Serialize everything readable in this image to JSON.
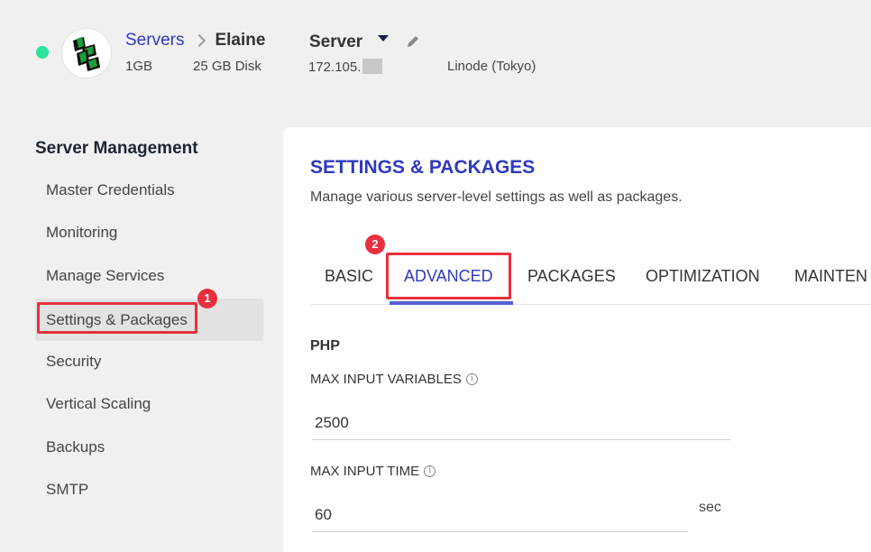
{
  "header": {
    "breadcrumb_link": "Servers",
    "breadcrumb_current": "Elaine",
    "server_label": "Server",
    "ram": "1GB",
    "disk": "25 GB Disk",
    "ip": "172.105.",
    "provider": "Linode (Tokyo)",
    "status_color": "#2ee29c"
  },
  "sidebar": {
    "title": "Server Management",
    "items": [
      {
        "label": "Master Credentials"
      },
      {
        "label": "Monitoring"
      },
      {
        "label": "Manage Services"
      },
      {
        "label": "Settings & Packages",
        "active": true
      },
      {
        "label": "Security"
      },
      {
        "label": "Vertical Scaling"
      },
      {
        "label": "Backups"
      },
      {
        "label": "SMTP"
      }
    ]
  },
  "annotations": {
    "step1": "1",
    "step2": "2"
  },
  "main": {
    "title": "SETTINGS & PACKAGES",
    "description": "Manage various server-level settings as well as packages.",
    "tabs": [
      {
        "label": "BASIC"
      },
      {
        "label": "ADVANCED",
        "active": true
      },
      {
        "label": "PACKAGES"
      },
      {
        "label": "OPTIMIZATION"
      },
      {
        "label": "MAINTEN"
      }
    ],
    "section": "PHP",
    "fields": [
      {
        "label": "MAX INPUT VARIABLES",
        "value": "2500"
      },
      {
        "label": "MAX INPUT TIME",
        "value": "60",
        "unit": "sec"
      }
    ]
  },
  "colors": {
    "accent": "#2f39bf",
    "annotation": "#e8303e"
  }
}
